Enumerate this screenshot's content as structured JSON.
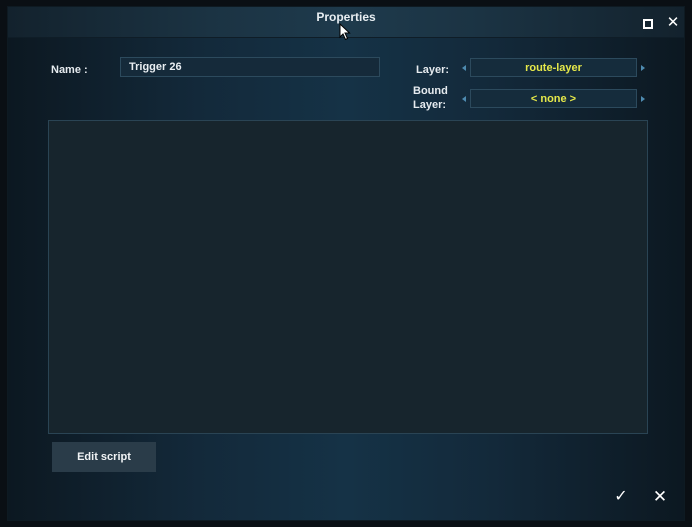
{
  "window": {
    "title": "Properties",
    "maximize_icon": "maximize-icon",
    "close_icon": "close-icon",
    "close_glyph": "✕"
  },
  "form": {
    "name_label": "Name :",
    "name_value": "Trigger 26",
    "layer_label": "Layer:",
    "layer_value": "route-layer",
    "bound_label_line1": "Bound",
    "bound_label_line2": "Layer:",
    "bound_value": "< none >",
    "accent_color": "#e5e84a"
  },
  "actions": {
    "edit_script_label": "Edit script",
    "confirm_glyph": "✓",
    "cancel_glyph": "✕"
  }
}
